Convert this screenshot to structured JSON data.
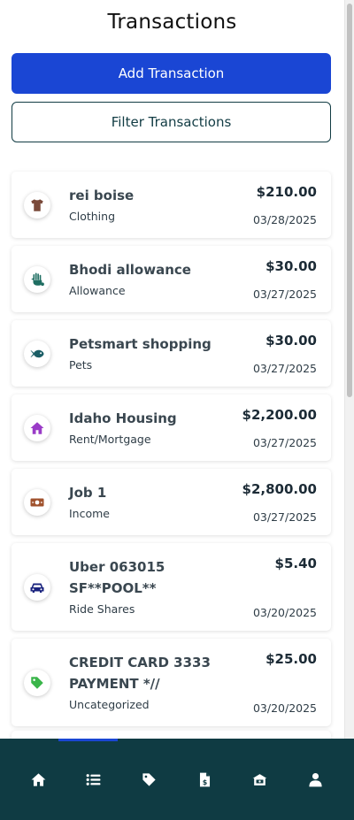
{
  "header": {
    "title": "Transactions"
  },
  "actions": {
    "add_label": "Add Transaction",
    "filter_label": "Filter Transactions"
  },
  "transactions": [
    {
      "name": "rei boise",
      "category": "Clothing",
      "amount": "$210.00",
      "date": "03/28/2025",
      "icon": "shirt-icon",
      "icon_color": "#7a4a3a"
    },
    {
      "name": "Bhodi allowance",
      "category": "Allowance",
      "amount": "$30.00",
      "date": "03/27/2025",
      "icon": "hand-coins-icon",
      "icon_color": "#1f6e62"
    },
    {
      "name": "Petsmart shopping",
      "category": "Pets",
      "amount": "$30.00",
      "date": "03/27/2025",
      "icon": "fish-icon",
      "icon_color": "#1b5e66"
    },
    {
      "name": "Idaho Housing",
      "category": "Rent/Mortgage",
      "amount": "$2,200.00",
      "date": "03/27/2025",
      "icon": "house-icon",
      "icon_color": "#9a3bc7"
    },
    {
      "name": "Job 1",
      "category": "Income",
      "amount": "$2,800.00",
      "date": "03/27/2025",
      "icon": "money-bill-icon",
      "icon_color": "#a0522d"
    },
    {
      "name": "Uber 063015 SF**POOL**",
      "category": "Ride Shares",
      "amount": "$5.40",
      "date": "03/20/2025",
      "icon": "car-icon",
      "icon_color": "#1a237e"
    },
    {
      "name": "CREDIT CARD 3333 PAYMENT *//",
      "category": "Uncategorized",
      "amount": "$25.00",
      "date": "03/20/2025",
      "icon": "tag-icon",
      "icon_color": "#3ab54a"
    }
  ],
  "nav": [
    {
      "id": "home",
      "icon": "home-icon",
      "active": true
    },
    {
      "id": "transactions",
      "icon": "list-icon",
      "active": false
    },
    {
      "id": "categories",
      "icon": "tag-icon",
      "active": false
    },
    {
      "id": "bills",
      "icon": "invoice-dollar-icon",
      "active": false
    },
    {
      "id": "savings",
      "icon": "piggy-bank-icon",
      "active": false
    },
    {
      "id": "profile",
      "icon": "user-icon",
      "active": false
    }
  ],
  "colors": {
    "primary": "#1a46d4",
    "nav_bg": "#0f3b43",
    "outline": "#123c44"
  }
}
